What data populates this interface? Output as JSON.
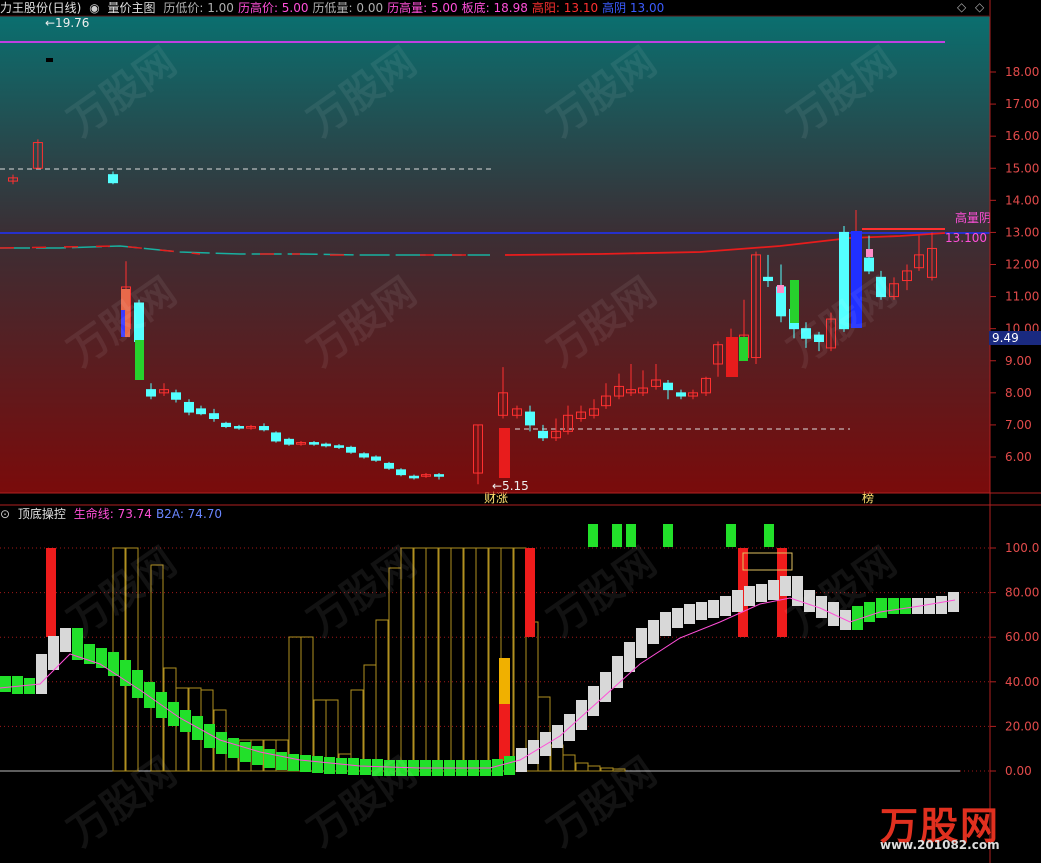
{
  "header": {
    "stock": "力王股份(日线)",
    "panel": "量价主图",
    "items": [
      {
        "label": "历低价:",
        "value": "1.00",
        "color": "#b0b0b0"
      },
      {
        "label": "历高价:",
        "value": "5.00",
        "color": "#ff4fd8"
      },
      {
        "label": "历低量:",
        "value": "0.00",
        "color": "#b0b0b0"
      },
      {
        "label": "历高量:",
        "value": "5.00",
        "color": "#ff4fd8"
      },
      {
        "label": "板底:",
        "value": "18.98",
        "color": "#ff4fd8"
      },
      {
        "label": "高阳:",
        "value": "13.10",
        "color": "#ff3030"
      },
      {
        "label": "高阴",
        "value": "13.00",
        "color": "#3b5cff"
      }
    ]
  },
  "sub_header": {
    "title": "顶底操控",
    "items": [
      {
        "label": "生命线:",
        "value": "73.74",
        "color": "#ff4fd8"
      },
      {
        "label": "B2A:",
        "value": "74.70",
        "color": "#6a86ff"
      }
    ]
  },
  "annotations": {
    "high_marker": "19.76",
    "low_marker": "5.15",
    "event1": "财涨",
    "event2": "榜",
    "resistance_label": "高量阴",
    "resistance_value": "13.100",
    "current_price": "9.49"
  },
  "axes": {
    "main_ticks": [
      "18.00",
      "17.00",
      "16.00",
      "15.00",
      "14.00",
      "13.00",
      "12.00",
      "11.00",
      "10.00",
      "9.00",
      "8.00",
      "7.00",
      "6.00"
    ],
    "sub_ticks": [
      "100.0",
      "80.00",
      "60.00",
      "40.00",
      "20.00",
      "0.00"
    ]
  },
  "colors": {
    "up": "#ff3030",
    "down": "#54ffff",
    "bull_fill": "#33e03a",
    "purple_line": "#c040e0",
    "blue_line": "#2030ff"
  },
  "watermark": {
    "text": "万股网",
    "url": "www.201082.com"
  },
  "chart_data": {
    "type": "candlestick",
    "ylim": [
      5.0,
      19.5
    ],
    "candles": [
      {
        "o": 14.6,
        "c": 14.7,
        "h": 14.8,
        "l": 14.5
      },
      {
        "o": 14.8,
        "c": 14.55,
        "h": 14.9,
        "l": 14.5
      },
      {
        "o": 15.0,
        "c": 15.8,
        "h": 15.9,
        "l": 15.0
      },
      {
        "o": 10.0,
        "c": 11.3,
        "h": 12.1,
        "l": 10.0
      },
      {
        "o": 10.8,
        "c": 9.6,
        "h": 10.9,
        "l": 9.5
      },
      {
        "o": 8.1,
        "c": 7.9,
        "h": 8.3,
        "l": 7.8
      },
      {
        "o": 8.0,
        "c": 8.1,
        "h": 8.3,
        "l": 7.9
      },
      {
        "o": 8.0,
        "c": 7.8,
        "h": 8.1,
        "l": 7.7
      },
      {
        "o": 7.7,
        "c": 7.4,
        "h": 7.8,
        "l": 7.3
      },
      {
        "o": 7.5,
        "c": 7.35,
        "h": 7.6,
        "l": 7.3
      },
      {
        "o": 7.35,
        "c": 7.2,
        "h": 7.5,
        "l": 7.1
      },
      {
        "o": 7.05,
        "c": 6.95,
        "h": 7.1,
        "l": 6.9
      },
      {
        "o": 6.95,
        "c": 6.9,
        "h": 7.0,
        "l": 6.85
      },
      {
        "o": 6.9,
        "c": 6.95,
        "h": 7.0,
        "l": 6.85
      },
      {
        "o": 6.95,
        "c": 6.85,
        "h": 7.05,
        "l": 6.8
      },
      {
        "o": 6.75,
        "c": 6.5,
        "h": 6.8,
        "l": 6.45
      },
      {
        "o": 6.55,
        "c": 6.4,
        "h": 6.6,
        "l": 6.35
      },
      {
        "o": 6.4,
        "c": 6.45,
        "h": 6.5,
        "l": 6.35
      },
      {
        "o": 6.45,
        "c": 6.4,
        "h": 6.5,
        "l": 6.35
      },
      {
        "o": 6.4,
        "c": 6.35,
        "h": 6.45,
        "l": 6.3
      },
      {
        "o": 6.35,
        "c": 6.3,
        "h": 6.4,
        "l": 6.25
      },
      {
        "o": 6.3,
        "c": 6.15,
        "h": 6.35,
        "l": 6.1
      },
      {
        "o": 6.1,
        "c": 6.0,
        "h": 6.15,
        "l": 5.95
      },
      {
        "o": 6.0,
        "c": 5.9,
        "h": 6.05,
        "l": 5.85
      },
      {
        "o": 5.8,
        "c": 5.65,
        "h": 5.85,
        "l": 5.6
      },
      {
        "o": 5.6,
        "c": 5.45,
        "h": 5.65,
        "l": 5.4
      },
      {
        "o": 5.4,
        "c": 5.35,
        "h": 5.45,
        "l": 5.3
      },
      {
        "o": 5.4,
        "c": 5.45,
        "h": 5.5,
        "l": 5.35
      },
      {
        "o": 5.45,
        "c": 5.4,
        "h": 5.5,
        "l": 5.3
      },
      {
        "o": 5.5,
        "c": 7.0,
        "h": 7.0,
        "l": 5.15
      },
      {
        "o": 7.3,
        "c": 8.0,
        "h": 8.8,
        "l": 7.2
      },
      {
        "o": 7.3,
        "c": 7.5,
        "h": 7.6,
        "l": 7.2
      },
      {
        "o": 7.4,
        "c": 7.0,
        "h": 7.6,
        "l": 6.8
      },
      {
        "o": 6.8,
        "c": 6.6,
        "h": 7.0,
        "l": 6.5
      },
      {
        "o": 6.6,
        "c": 6.8,
        "h": 7.2,
        "l": 6.5
      },
      {
        "o": 6.8,
        "c": 7.3,
        "h": 7.6,
        "l": 6.7
      },
      {
        "o": 7.2,
        "c": 7.4,
        "h": 7.6,
        "l": 7.1
      },
      {
        "o": 7.3,
        "c": 7.5,
        "h": 7.8,
        "l": 7.2
      },
      {
        "o": 7.6,
        "c": 7.9,
        "h": 8.3,
        "l": 7.5
      },
      {
        "o": 7.9,
        "c": 8.2,
        "h": 8.6,
        "l": 7.8
      },
      {
        "o": 8.0,
        "c": 8.1,
        "h": 8.9,
        "l": 7.9
      },
      {
        "o": 8.0,
        "c": 8.15,
        "h": 8.7,
        "l": 7.9
      },
      {
        "o": 8.2,
        "c": 8.4,
        "h": 8.9,
        "l": 8.1
      },
      {
        "o": 8.3,
        "c": 8.1,
        "h": 8.4,
        "l": 7.8
      },
      {
        "o": 8.0,
        "c": 7.9,
        "h": 8.1,
        "l": 7.8
      },
      {
        "o": 7.9,
        "c": 8.0,
        "h": 8.1,
        "l": 7.8
      },
      {
        "o": 8.0,
        "c": 8.45,
        "h": 8.5,
        "l": 7.9
      },
      {
        "o": 8.9,
        "c": 9.5,
        "h": 9.6,
        "l": 8.5
      },
      {
        "o": 9.0,
        "c": 9.4,
        "h": 10.0,
        "l": 8.9
      },
      {
        "o": 9.1,
        "c": 9.8,
        "h": 10.9,
        "l": 9.0
      },
      {
        "o": 9.1,
        "c": 12.3,
        "h": 12.4,
        "l": 8.9
      },
      {
        "o": 11.6,
        "c": 11.5,
        "h": 12.3,
        "l": 11.3
      },
      {
        "o": 11.3,
        "c": 10.4,
        "h": 12.0,
        "l": 10.2
      },
      {
        "o": 10.6,
        "c": 10.0,
        "h": 10.7,
        "l": 9.7
      },
      {
        "o": 10.0,
        "c": 9.7,
        "h": 10.2,
        "l": 9.4
      },
      {
        "o": 9.8,
        "c": 9.6,
        "h": 9.9,
        "l": 9.3
      },
      {
        "o": 9.4,
        "c": 10.3,
        "h": 10.5,
        "l": 9.3
      },
      {
        "o": 13.0,
        "c": 10.0,
        "h": 13.2,
        "l": 9.9
      },
      {
        "o": 12.4,
        "c": 12.6,
        "h": 13.7,
        "l": 12.3
      },
      {
        "o": 12.2,
        "c": 11.8,
        "h": 12.9,
        "l": 11.7
      },
      {
        "o": 11.6,
        "c": 11.0,
        "h": 11.8,
        "l": 10.9
      },
      {
        "o": 11.0,
        "c": 11.4,
        "h": 11.6,
        "l": 10.9
      },
      {
        "o": 11.5,
        "c": 11.8,
        "h": 12.0,
        "l": 11.2
      },
      {
        "o": 11.9,
        "c": 12.3,
        "h": 12.9,
        "l": 11.8
      },
      {
        "o": 11.6,
        "c": 12.5,
        "h": 13.0,
        "l": 11.5
      }
    ]
  }
}
